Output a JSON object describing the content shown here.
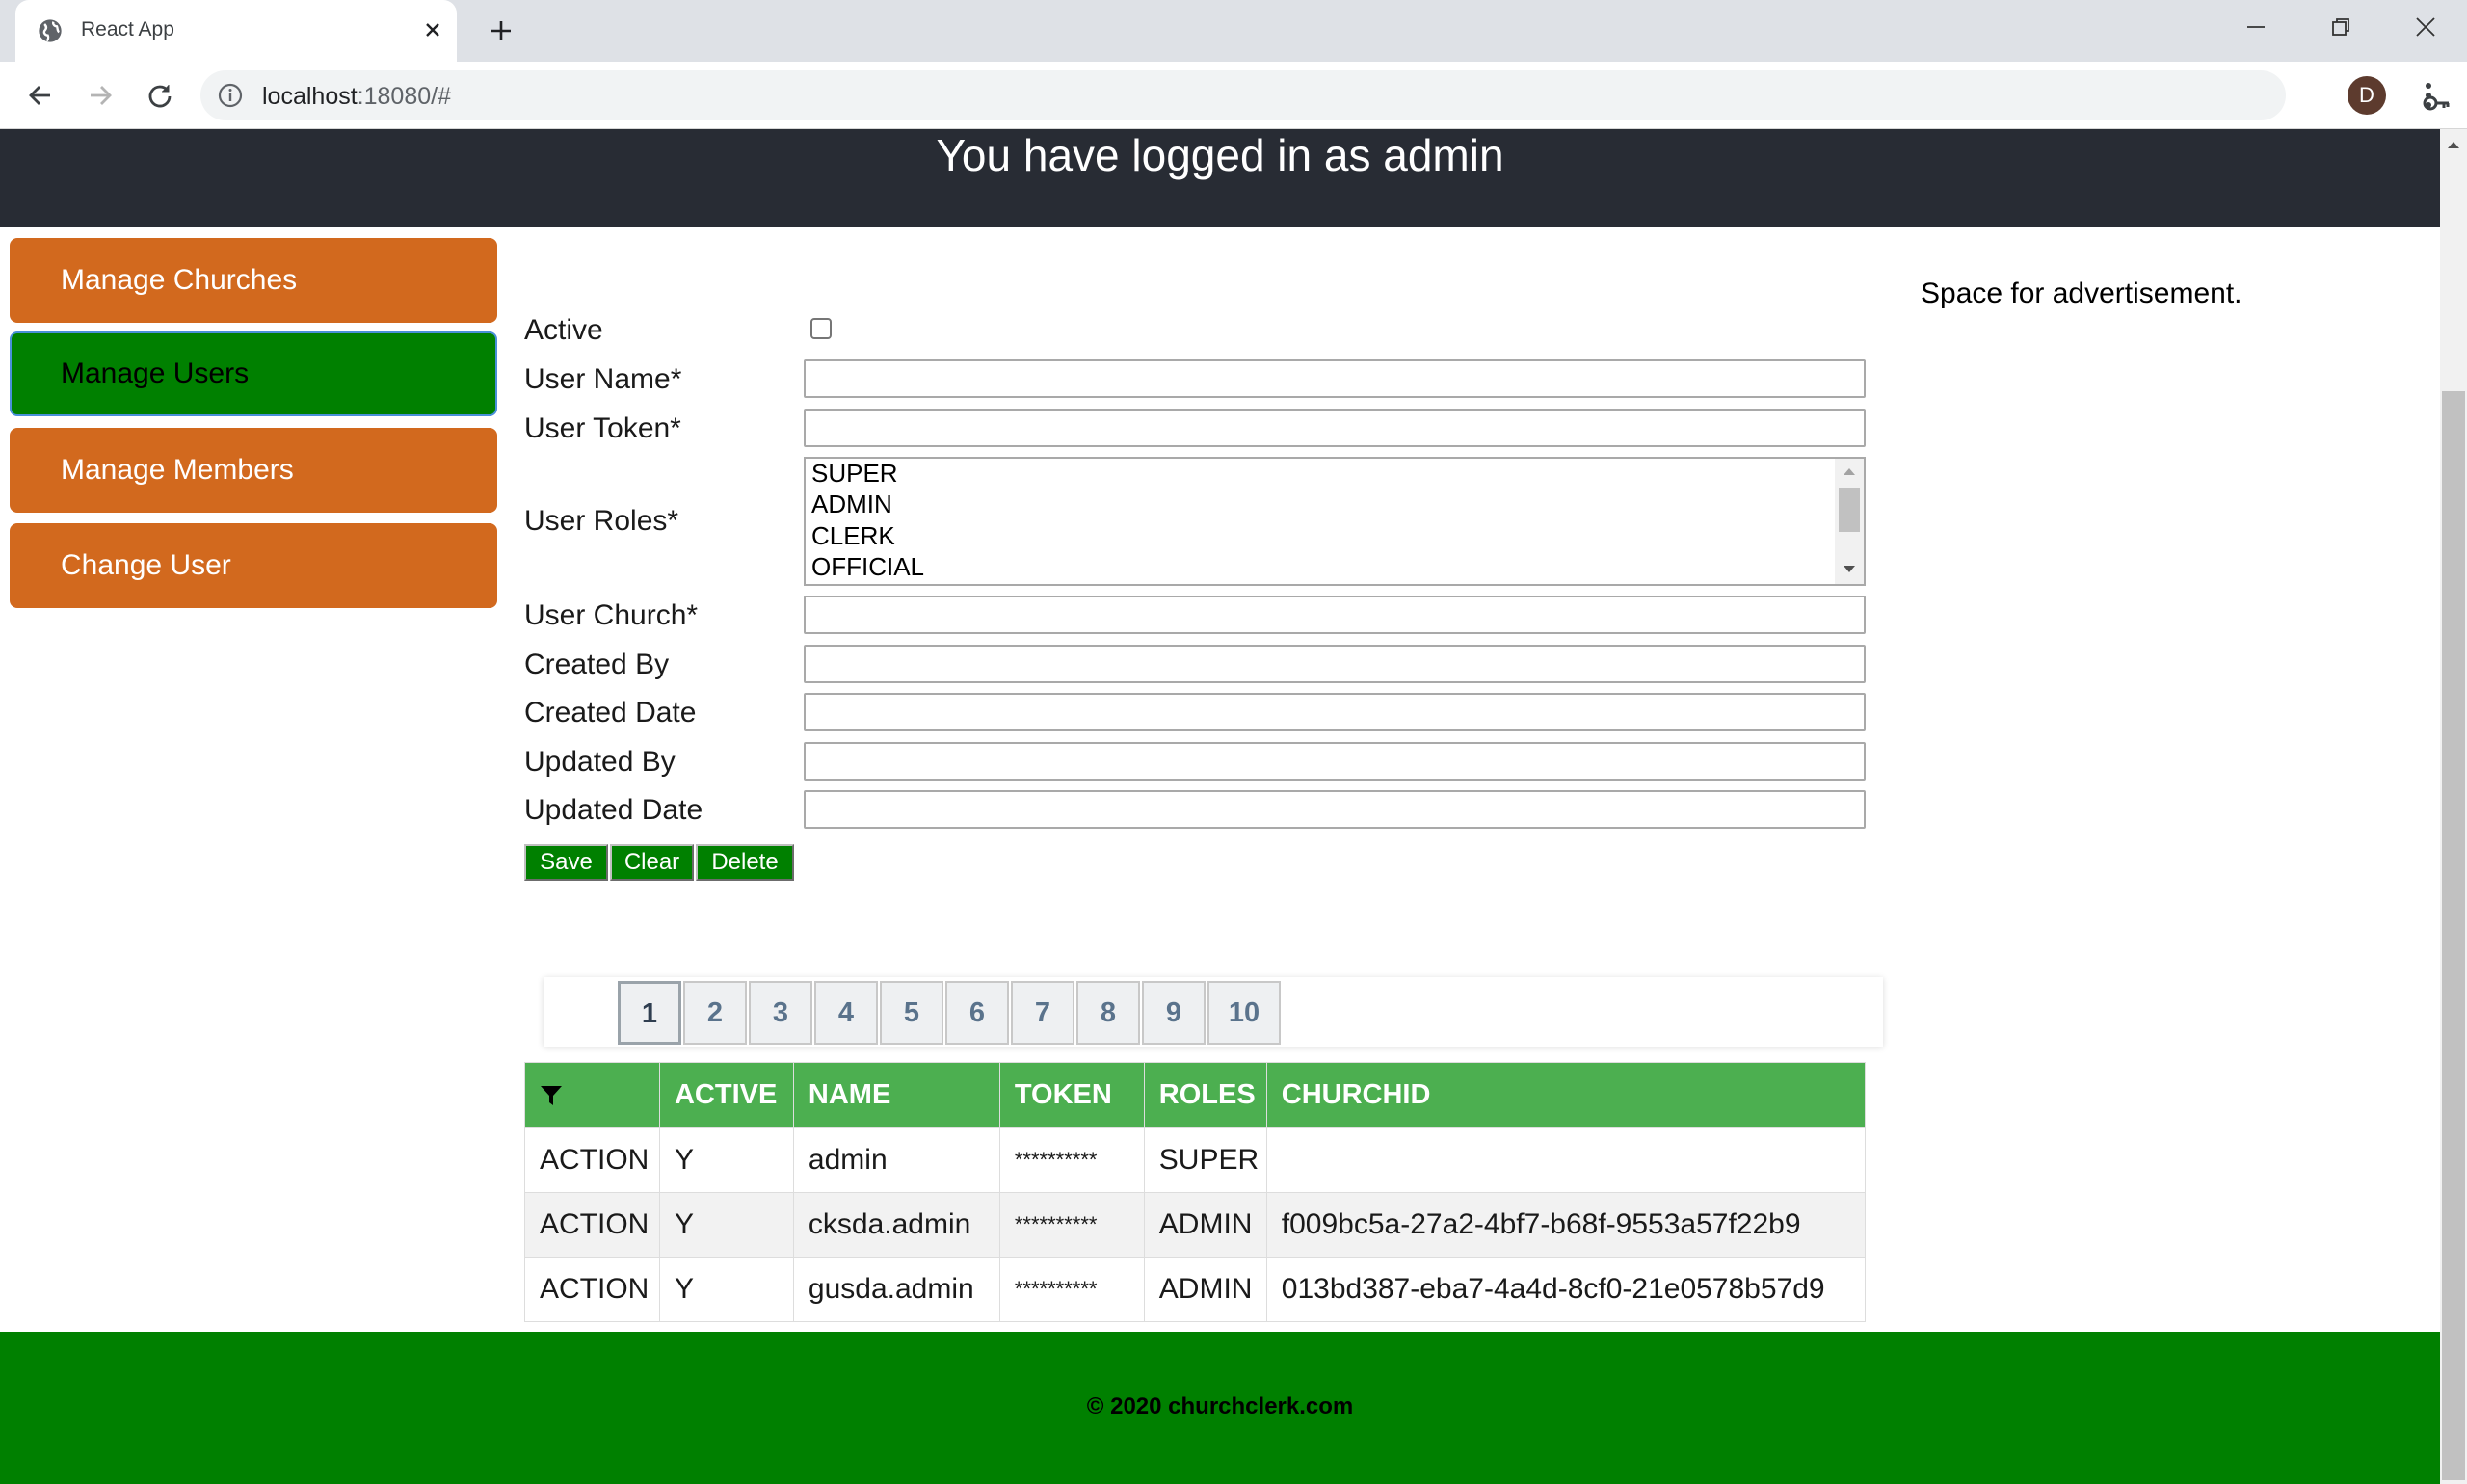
{
  "browser": {
    "tab_title": "React App",
    "url_host": "localhost",
    "url_rest": ":18080/#",
    "avatar_letter": "D"
  },
  "header": {
    "title": "You have logged in as admin"
  },
  "sidebar": {
    "items": [
      {
        "label": "Manage Churches",
        "active": false
      },
      {
        "label": "Manage Users",
        "active": true
      },
      {
        "label": "Manage Members",
        "active": false
      },
      {
        "label": "Change User",
        "active": false
      }
    ]
  },
  "form": {
    "active_label": "Active",
    "active_checked": false,
    "user_name_label": "User Name*",
    "user_name_value": "",
    "user_token_label": "User Token*",
    "user_token_value": "",
    "user_roles_label": "User Roles*",
    "user_roles_options": [
      "SUPER",
      "ADMIN",
      "CLERK",
      "OFFICIAL"
    ],
    "user_church_label": "User Church*",
    "user_church_value": "",
    "created_by_label": "Created By",
    "created_by_value": "",
    "created_date_label": "Created Date",
    "created_date_value": "",
    "updated_by_label": "Updated By",
    "updated_by_value": "",
    "updated_date_label": "Updated Date",
    "updated_date_value": "",
    "save_label": "Save",
    "clear_label": "Clear",
    "delete_label": "Delete"
  },
  "ad": {
    "text": "Space for advertisement."
  },
  "pagination": {
    "pages": [
      "1",
      "2",
      "3",
      "4",
      "5",
      "6",
      "7",
      "8",
      "9",
      "10"
    ],
    "current": "1"
  },
  "table": {
    "headers": [
      "",
      "ACTIVE",
      "NAME",
      "TOKEN",
      "ROLES",
      "CHURCHID"
    ],
    "rows": [
      {
        "action": "ACTION",
        "active": "Y",
        "name": "admin",
        "token": "**********",
        "roles": "SUPER",
        "churchid": ""
      },
      {
        "action": "ACTION",
        "active": "Y",
        "name": "cksda.admin",
        "token": "**********",
        "roles": "ADMIN",
        "churchid": "f009bc5a-27a2-4bf7-b68f-9553a57f22b9"
      },
      {
        "action": "ACTION",
        "active": "Y",
        "name": "gusda.admin",
        "token": "**********",
        "roles": "ADMIN",
        "churchid": "013bd387-eba7-4a4d-8cf0-21e0578b57d9"
      }
    ]
  },
  "footer": {
    "text": "© 2020 churchclerk.com"
  },
  "colors": {
    "sidebar_button": "#d2691e",
    "sidebar_active": "#008000",
    "header_bg": "#282c34",
    "table_header": "#4caf50",
    "footer_bg": "#008000"
  }
}
